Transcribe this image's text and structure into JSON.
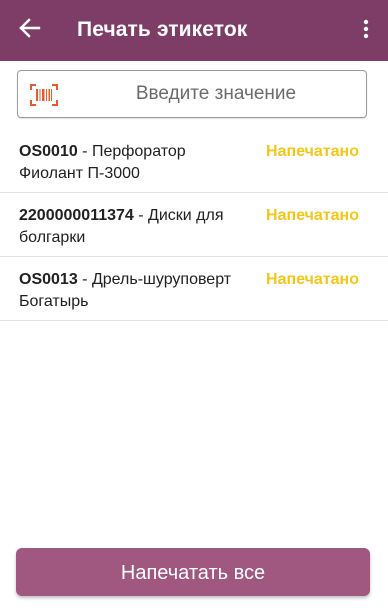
{
  "header": {
    "back_icon": "arrow-left-icon",
    "title": "Печать этикеток",
    "menu_icon": "more-vert-icon",
    "background_color": "#7e3d66"
  },
  "search": {
    "icon": "barcode-scan-icon",
    "placeholder": "Введите значение",
    "value": ""
  },
  "items": [
    {
      "code": "OS0010",
      "name": " - Перфоратор Фиолант П-3000",
      "status": "Напечатано"
    },
    {
      "code": "2200000011374",
      "name": " - Диски для болгарки",
      "status": "Напечатано"
    },
    {
      "code": "OS0013",
      "name": " - Дрель-шуруповерт Богатырь",
      "status": "Напечатано"
    }
  ],
  "status_color": "#f4c61a",
  "footer": {
    "print_all_label": "Напечатать все",
    "button_color": "#a05880"
  }
}
